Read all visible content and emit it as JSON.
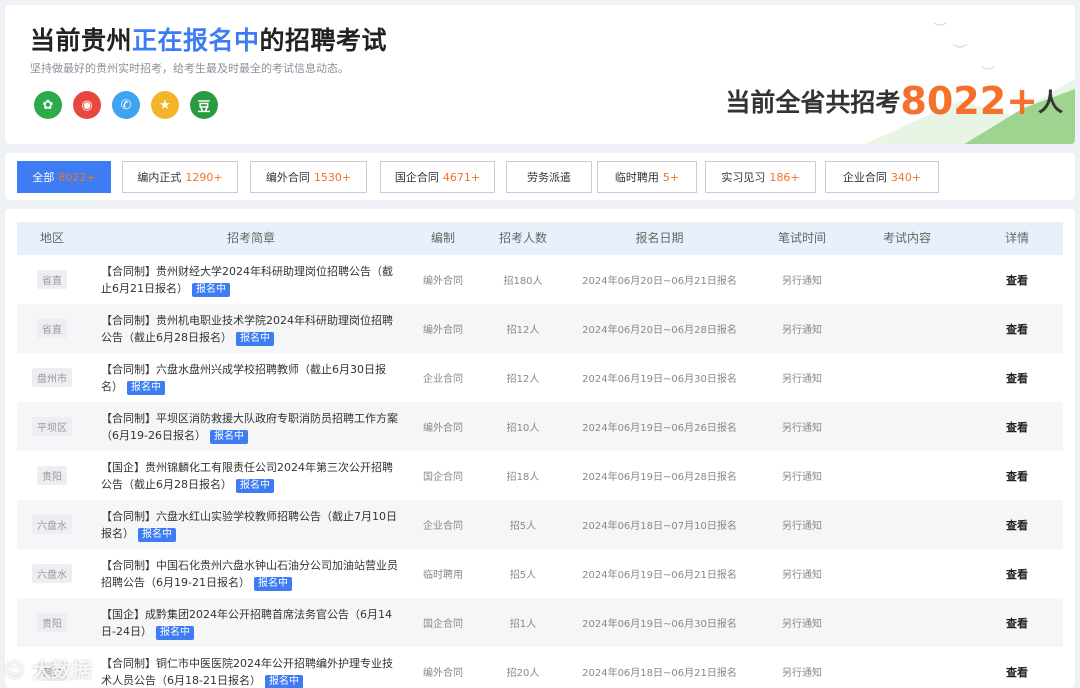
{
  "hero": {
    "title_prefix": "当前贵州",
    "title_highlight": "正在报名中",
    "title_suffix": "的招聘考试",
    "subtitle": "坚持做最好的贵州实时招考，给考生最及时最全的考试信息动态。",
    "total_prefix": "当前全省共招考",
    "total_count": "8022+",
    "total_suffix": "人",
    "share_icons": [
      {
        "name": "wechat-icon",
        "glyph": "✿"
      },
      {
        "name": "weibo-icon",
        "glyph": "◉"
      },
      {
        "name": "qq-icon",
        "glyph": "✆"
      },
      {
        "name": "favorite-icon",
        "glyph": "★"
      },
      {
        "name": "douban-icon",
        "glyph": "豆"
      }
    ]
  },
  "tabs": [
    {
      "label": "全部",
      "count": "8022+"
    },
    {
      "label": "编内正式",
      "count": "1290+"
    },
    {
      "label": "编外合同",
      "count": "1530+"
    },
    {
      "label": "国企合同",
      "count": "4671+"
    },
    {
      "label": "劳务派遣",
      "count": ""
    },
    {
      "label": "临时聘用",
      "count": "5+"
    },
    {
      "label": "实习见习",
      "count": "186+"
    },
    {
      "label": "企业合同",
      "count": "340+"
    }
  ],
  "table": {
    "headers": [
      "地区",
      "招考简章",
      "编制",
      "招考人数",
      "报名日期",
      "笔试时间",
      "考试内容",
      "详情"
    ],
    "status_label": "报名中",
    "view_label": "查看",
    "rows": [
      {
        "region": "省直",
        "title": "【合同制】贵州财经大学2024年科研助理岗位招聘公告（截止6月21日报名）",
        "type": "编外合同",
        "count": "招180人",
        "date": "2024年06月20日~06月21日报名",
        "exam": "另行通知"
      },
      {
        "region": "省直",
        "title": "【合同制】贵州机电职业技术学院2024年科研助理岗位招聘公告（截止6月28日报名）",
        "type": "编外合同",
        "count": "招12人",
        "date": "2024年06月20日~06月28日报名",
        "exam": "另行通知"
      },
      {
        "region": "盘州市",
        "title": "【合同制】六盘水盘州兴成学校招聘教师（截止6月30日报名）",
        "type": "企业合同",
        "count": "招12人",
        "date": "2024年06月19日~06月30日报名",
        "exam": "另行通知"
      },
      {
        "region": "平坝区",
        "title": "【合同制】平坝区消防救援大队政府专职消防员招聘工作方案（6月19-26日报名）",
        "type": "编外合同",
        "count": "招10人",
        "date": "2024年06月19日~06月26日报名",
        "exam": "另行通知"
      },
      {
        "region": "贵阳",
        "title": "【国企】贵州锦麟化工有限责任公司2024年第三次公开招聘公告（截止6月28日报名）",
        "type": "国企合同",
        "count": "招18人",
        "date": "2024年06月19日~06月28日报名",
        "exam": "另行通知"
      },
      {
        "region": "六盘水",
        "title": "【合同制】六盘水红山实验学校教师招聘公告（截止7月10日报名）",
        "type": "企业合同",
        "count": "招5人",
        "date": "2024年06月18日~07月10日报名",
        "exam": "另行通知"
      },
      {
        "region": "六盘水",
        "title": "【合同制】中国石化贵州六盘水钟山石油分公司加油站营业员招聘公告（6月19-21日报名）",
        "type": "临时聘用",
        "count": "招5人",
        "date": "2024年06月19日~06月21日报名",
        "exam": "另行通知"
      },
      {
        "region": "贵阳",
        "title": "【国企】成黔集团2024年公开招聘首席法务官公告（6月14日-24日）",
        "type": "国企合同",
        "count": "招1人",
        "date": "2024年06月19日~06月30日报名",
        "exam": "另行通知"
      },
      {
        "region": "铜仁",
        "title": "【合同制】铜仁市中医医院2024年公开招聘编外护理专业技术人员公告（6月18-21日报名）",
        "type": "编外合同",
        "count": "招20人",
        "date": "2024年06月18日~06月21日报名",
        "exam": "另行通知"
      }
    ]
  },
  "watermark": "大数据"
}
